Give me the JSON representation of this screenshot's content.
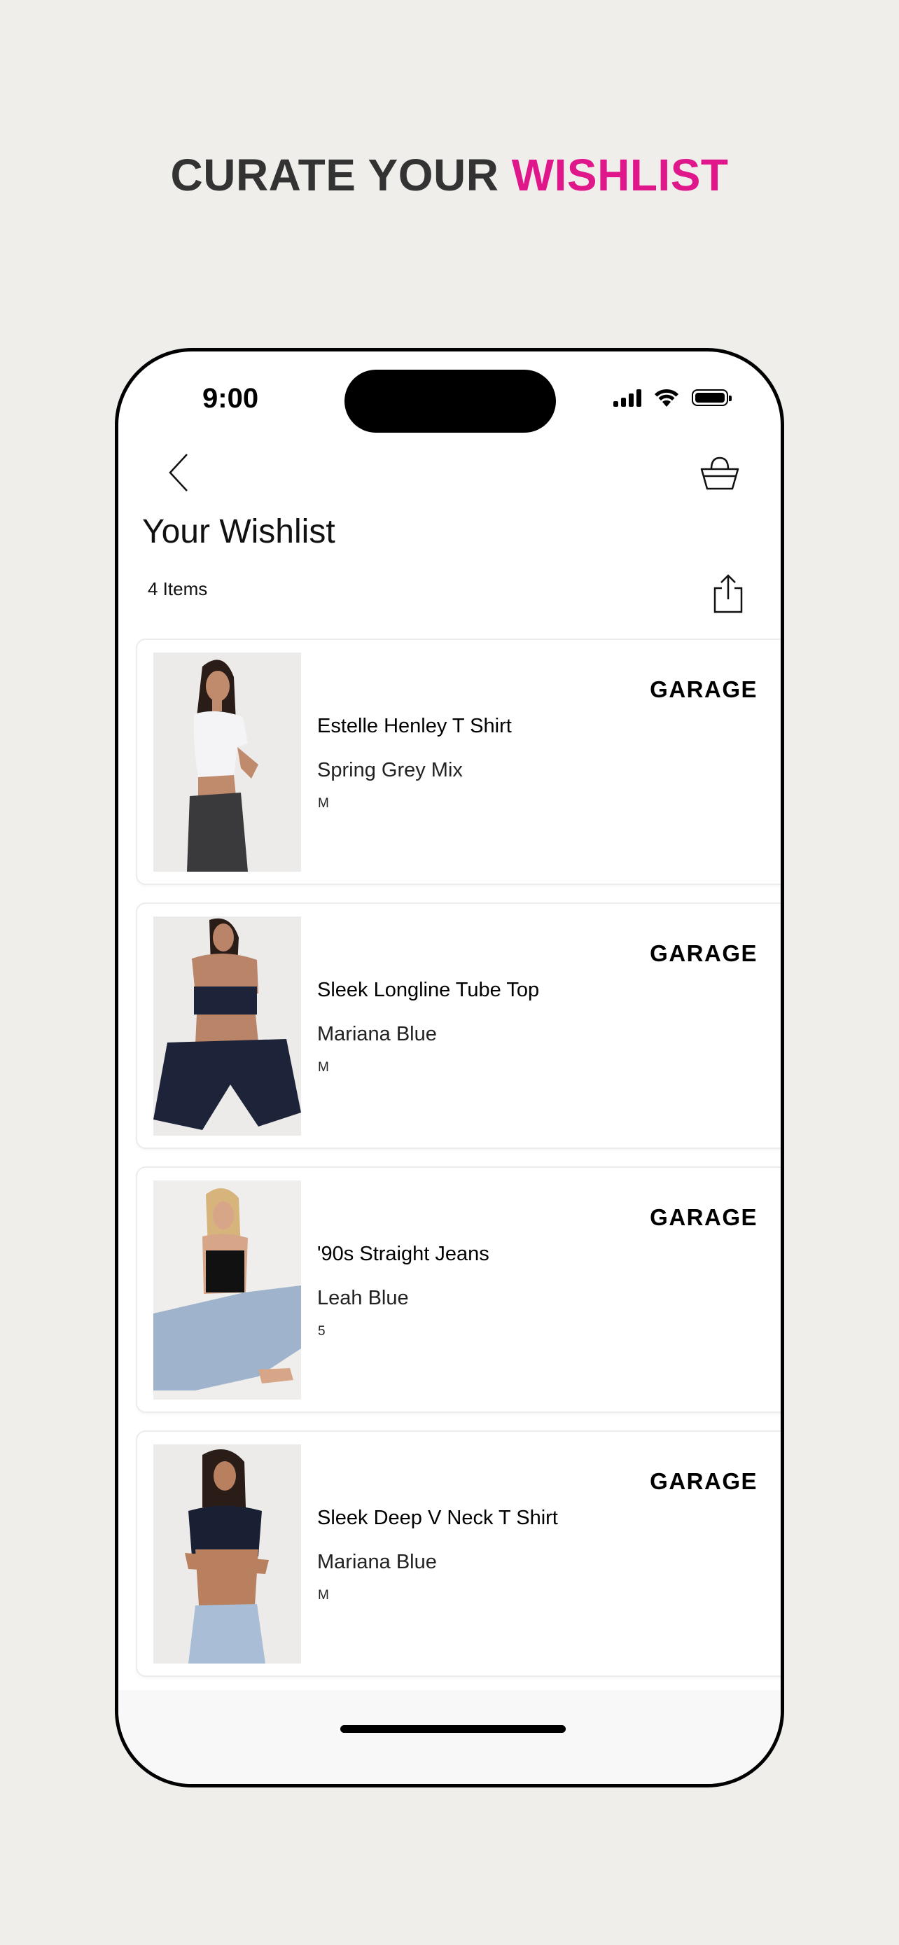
{
  "headline": {
    "part1": "CURATE YOUR ",
    "part2": "WISHLIST",
    "accent_color": "#e0168b"
  },
  "status_bar": {
    "time": "9:00"
  },
  "header": {
    "back_icon": "chevron-left-icon",
    "bag_icon": "shopping-bag-icon",
    "title": "Your Wishlist",
    "item_count": "4 Items",
    "share_icon": "share-icon"
  },
  "items": [
    {
      "brand": "GARAGE",
      "name": "Estelle Henley T Shirt",
      "color": "Spring Grey Mix",
      "size": "M"
    },
    {
      "brand": "GARAGE",
      "name": "Sleek Longline Tube Top",
      "color": "Mariana Blue",
      "size": "M"
    },
    {
      "brand": "GARAGE",
      "name": "'90s Straight Jeans",
      "color": "Leah Blue",
      "size": "5"
    },
    {
      "brand": "GARAGE",
      "name": "Sleek Deep V Neck T Shirt",
      "color": "Mariana Blue",
      "size": "M"
    }
  ]
}
